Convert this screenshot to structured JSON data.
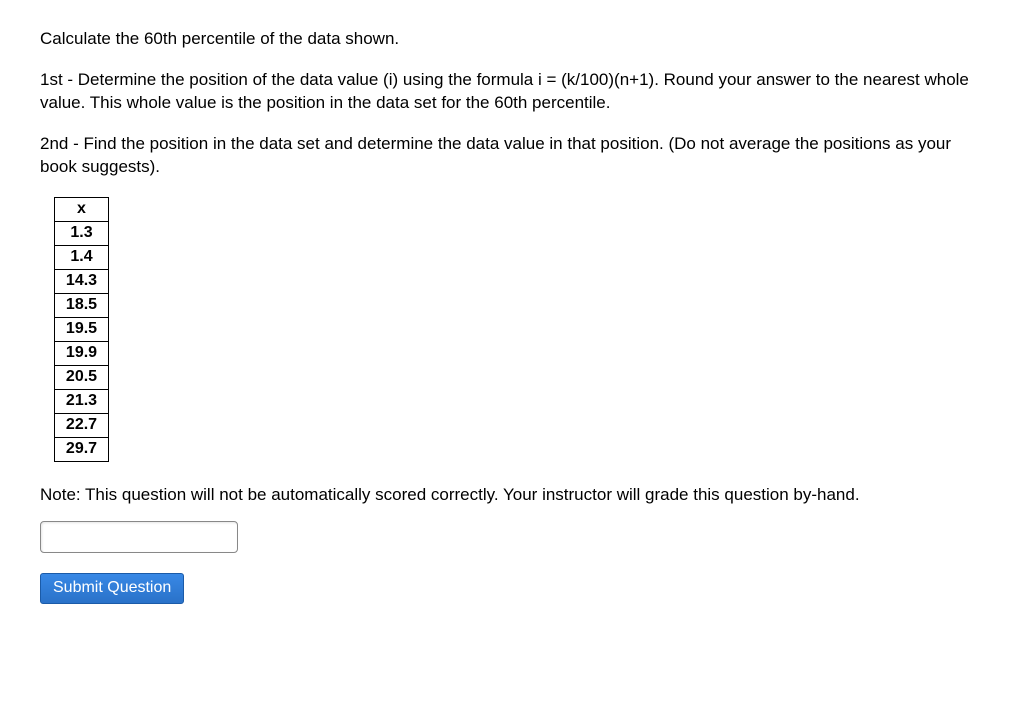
{
  "question": {
    "title": "Calculate the 60th percentile of the data shown.",
    "step1": "1st - Determine the position of the data value (i) using the formula i = (k/100)(n+1). Round your answer to the nearest whole value. This whole value is the position in the data set for the 60th percentile.",
    "step2": "2nd - Find the position in the data set and determine the data value in that position. (Do not average the positions as your book suggests)."
  },
  "table": {
    "header": "x",
    "values": [
      "1.3",
      "1.4",
      "14.3",
      "18.5",
      "19.5",
      "19.9",
      "20.5",
      "21.3",
      "22.7",
      "29.7"
    ]
  },
  "note": "Note: This question will not be automatically scored correctly. Your instructor will grade this question by-hand.",
  "answer": {
    "value": ""
  },
  "submit_label": "Submit Question"
}
